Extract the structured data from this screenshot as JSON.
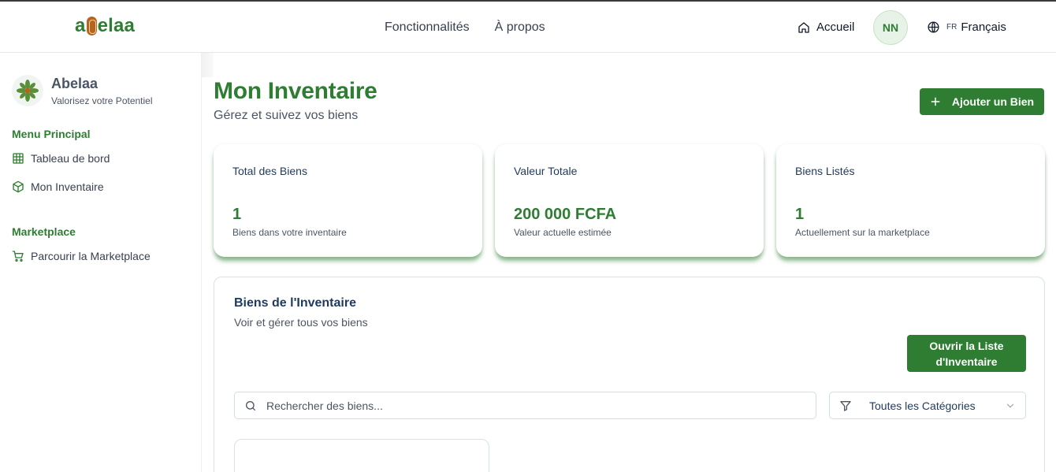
{
  "header": {
    "logo_pre": "a",
    "logo_post": "elaa",
    "nav": [
      "Fonctionnalités",
      "À propos"
    ],
    "home_label": "Accueil",
    "avatar_initials": "NN",
    "lang_code": "FR",
    "lang_label": "Français"
  },
  "sidebar": {
    "brand_name": "Abelaa",
    "brand_tagline": "Valorisez votre Potentiel",
    "sections": [
      {
        "title": "Menu Principal",
        "items": [
          "Tableau de bord",
          "Mon Inventaire"
        ]
      },
      {
        "title": "Marketplace",
        "items": [
          "Parcourir la Marketplace"
        ]
      }
    ]
  },
  "page": {
    "title": "Mon Inventaire",
    "subtitle": "Gérez et suivez vos biens",
    "add_button": "Ajouter un Bien"
  },
  "stats": [
    {
      "label": "Total des Biens",
      "value": "1",
      "desc": "Biens dans votre inventaire"
    },
    {
      "label": "Valeur Totale",
      "value": "200 000 FCFA",
      "desc": "Valeur actuelle estimée"
    },
    {
      "label": "Biens Listés",
      "value": "1",
      "desc": "Actuellement sur la marketplace"
    }
  ],
  "inventory": {
    "title": "Biens de l'Inventaire",
    "subtitle": "Voir et gérer tous vos biens",
    "open_button_line1": "Ouvrir la Liste",
    "open_button_line2": "d'Inventaire",
    "search_placeholder": "Rechercher des biens...",
    "category_selected": "Toutes les Catégories"
  },
  "colors": {
    "brand_green": "#2e7d32",
    "heading_navy": "#1e3a5f",
    "bean_brown": "#b5651d"
  },
  "icons": [
    "home-icon",
    "globe-icon",
    "grid-icon",
    "box-icon",
    "cart-icon",
    "plus-icon",
    "search-icon",
    "filter-icon",
    "chevron-down-icon"
  ]
}
